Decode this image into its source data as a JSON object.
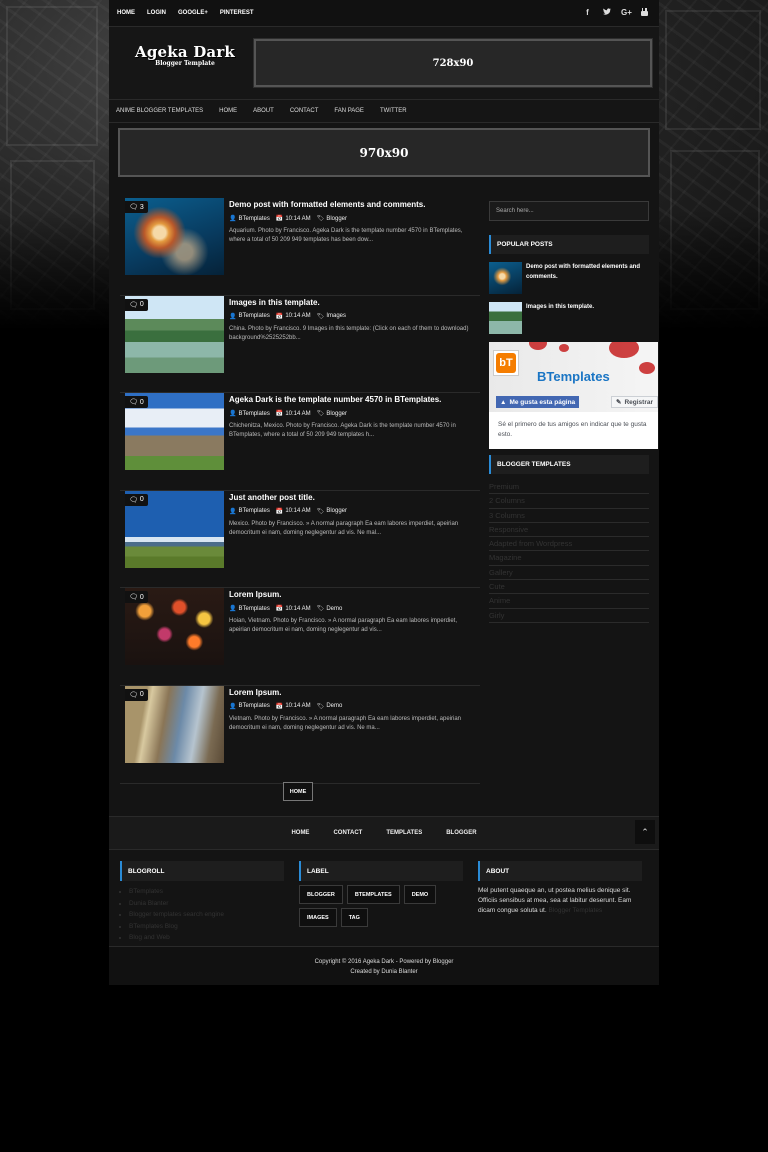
{
  "topbar": {
    "links": [
      "HOME",
      "LOGIN",
      "GOOGLE+",
      "PINTEREST"
    ],
    "social_icons": [
      "facebook-icon",
      "twitter-icon",
      "google-plus-icon",
      "youtube-icon"
    ]
  },
  "header": {
    "logo_title": "Ageka Dark",
    "logo_subtitle": "Blogger Template",
    "ad_top": "728x90"
  },
  "menu": [
    "ANIME BLOGGER TEMPLATES",
    "HOME",
    "ABOUT",
    "CONTACT",
    "FAN PAGE",
    "TWITTER"
  ],
  "ad_wide": "970x90",
  "posts": [
    {
      "comments": "3",
      "title": "Demo post with formatted elements and comments.",
      "author": "BTemplates",
      "time": "10:14 AM",
      "label": "Blogger",
      "summary": "Aquarium. Photo by Francisco. Ageka Dark is the template number 4570 in BTemplates, where a total of 50 209 949 templates has been dow..."
    },
    {
      "comments": "0",
      "title": "Images in this template.",
      "author": "BTemplates",
      "time": "10:14 AM",
      "label": "Images",
      "summary": "China. Photo by Francisco. 9 Images in this template: (Click on each of them to download) background%2525252bb..."
    },
    {
      "comments": "0",
      "title": "Ageka Dark is the template number 4570 in BTemplates.",
      "author": "BTemplates",
      "time": "10:14 AM",
      "label": "Blogger",
      "summary": "Chichenitza, Mexico. Photo by Francisco. Ageka Dark is the template number 4570 in BTemplates, where a total of 50 209 949 templates h..."
    },
    {
      "comments": "0",
      "title": "Just another post title.",
      "author": "BTemplates",
      "time": "10:14 AM",
      "label": "Blogger",
      "summary": "Mexico. Photo by Francisco. » A normal paragraph Ea eam labores imperdiet, apeirian democritum ei nam, doming neglegentur ad vis. Ne mal..."
    },
    {
      "comments": "0",
      "title": "Lorem Ipsum.",
      "author": "BTemplates",
      "time": "10:14 AM",
      "label": "Demo",
      "summary": "Hoian, Vietnam. Photo by Francisco. » A normal paragraph Ea eam labores imperdiet, apeirian democritum ei nam, doming neglegentur ad vis..."
    },
    {
      "comments": "0",
      "title": "Lorem Ipsum.",
      "author": "BTemplates",
      "time": "10:14 AM",
      "label": "Demo",
      "summary": "Vietnam. Photo by Francisco. » A normal paragraph Ea eam labores imperdiet, apeirian democritum ei nam, doming neglegentur ad vis. Ne ma..."
    }
  ],
  "pagination": {
    "home": "HOME"
  },
  "sidebar": {
    "search_placeholder": "Search here...",
    "popular_title": "POPULAR POSTS",
    "popular": [
      {
        "title": "Demo post with formatted elements and comments."
      },
      {
        "title": "Images in this template."
      }
    ],
    "facebook": {
      "name": "BTemplates",
      "like": "Me gusta esta página",
      "register": "Registrar",
      "text": "Sé el primero de tus amigos en indicar que te gusta esto."
    },
    "categories_title": "BLOGGER TEMPLATES",
    "categories": [
      "Premium",
      "2 Columns",
      "3 Columns",
      "Responsive",
      "Adapted from Wordpress",
      "Magazine",
      "Gallery",
      "Cute",
      "Anime",
      "Girly"
    ]
  },
  "footer_nav": [
    "HOME",
    "CONTACT",
    "TEMPLATES",
    "BLOGGER"
  ],
  "footer": {
    "blogroll_title": "BLOGROLL",
    "blogroll": [
      "BTemplates",
      "Dunia Blanter",
      "Blogger templates search engine",
      "BTemplates Blog",
      "Blog and Web"
    ],
    "label_title": "LABEL",
    "labels": [
      "BLOGGER",
      "BTEMPLATES",
      "DEMO",
      "IMAGES",
      "TAG"
    ],
    "about_title": "ABOUT",
    "about_text": "Mel putent quaeque an, ut postea melius denique sit. Officiis sensibus at mea, sea at labitur deserunt. Eam dicam congue soluta ut.",
    "about_link": "Blogger Templates"
  },
  "copyright": {
    "line1": "Copyright © 2016 Ageka Dark - Powered by Blogger",
    "line2": "Created by Dunia Blanter"
  },
  "colors": {
    "accent": "#2a8bd6",
    "background": "#141414",
    "page": "#000000"
  }
}
